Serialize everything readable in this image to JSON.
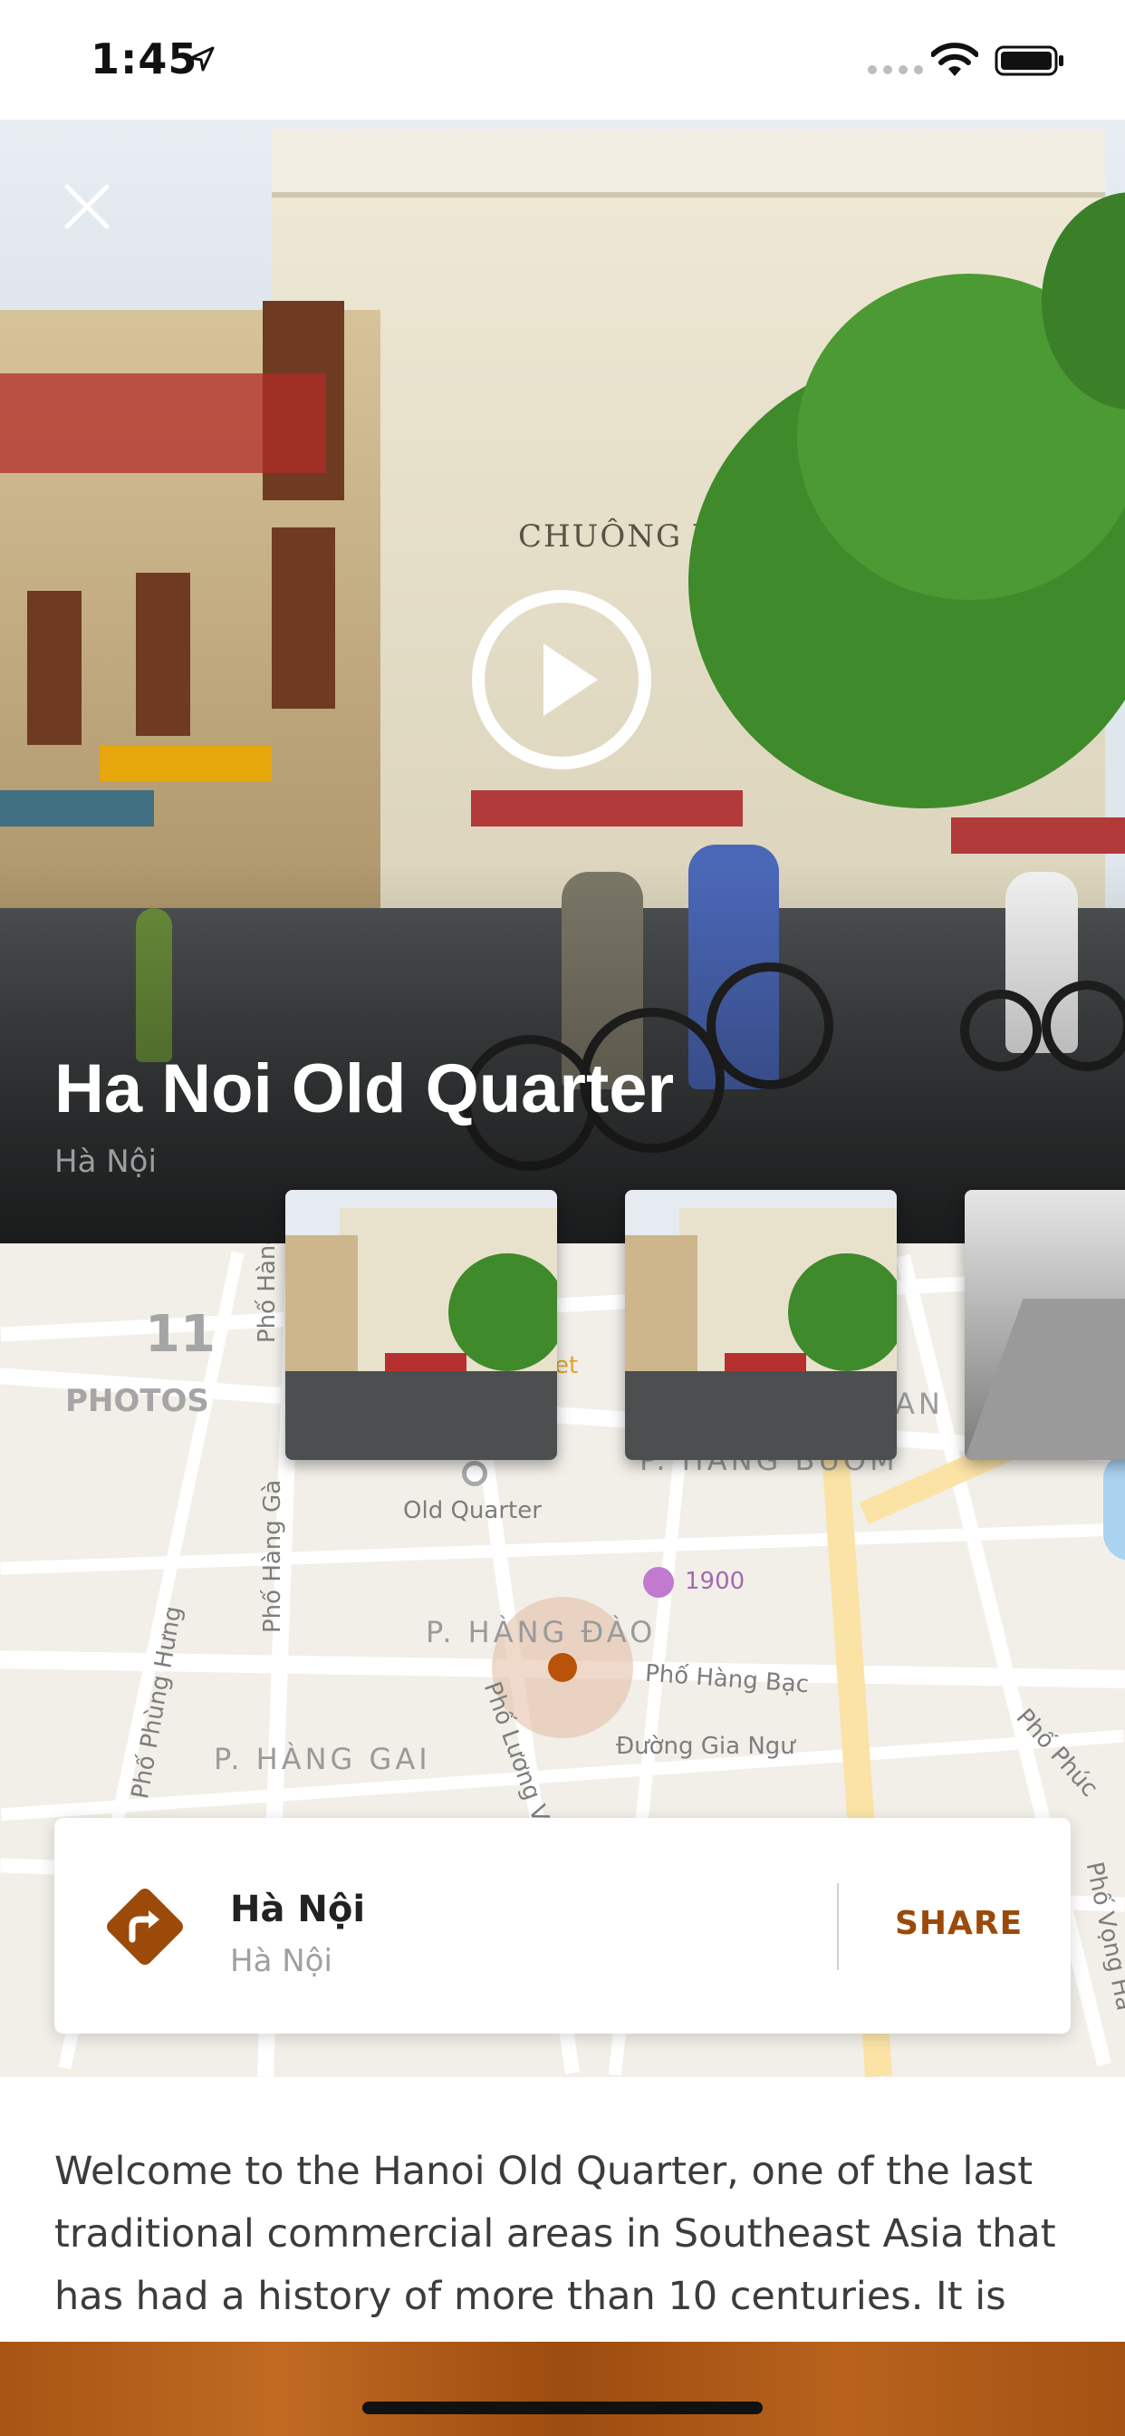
{
  "status_bar": {
    "time": "1:45"
  },
  "hero": {
    "title": "Ha Noi Old Quarter",
    "subtitle": "Hà Nội",
    "signage_text": "CHUÔNG VAN"
  },
  "photos": {
    "count": "11",
    "label": "PHOTOS"
  },
  "map": {
    "labels": {
      "hang_cot": "Phố Hàng Cót",
      "hang_ga": "Phố Hàng Gà",
      "phung_hung": "Phố Phùng Hưng",
      "old_quarter": "Old Quarter",
      "bar_1900": "1900",
      "hang_dao": "P. HÀNG ĐÀO",
      "hang_bac": "Phố Hàng Bạc",
      "luong_van": "Phố Lương Văn",
      "gia_ngu": "Đường Gia Ngư",
      "hang_gai": "P. HÀNG GAI",
      "hang_buom": "P. HÀNG BUỒM",
      "phuc": "Phố Phúc",
      "vong": "Phố Vọng Hà",
      "et": "et",
      "an": "AN"
    }
  },
  "location_card": {
    "title": "Hà Nội",
    "subtitle": "Hà Nội",
    "share_label": "SHARE"
  },
  "description": "Welcome to the Hanoi Old Quarter, one of the last traditional commercial areas in Southeast Asia that has had a history of more than 10 centuries. It is",
  "colors": {
    "accent": "#9b4a0a",
    "pin": "#b9530a"
  }
}
